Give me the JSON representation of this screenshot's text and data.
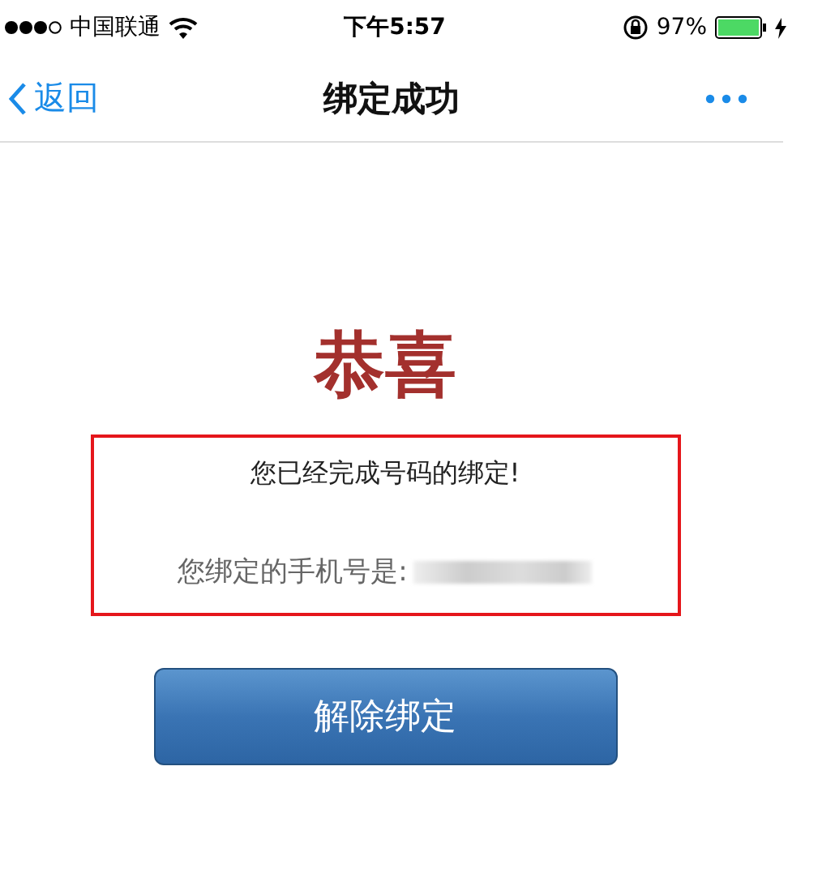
{
  "status_bar": {
    "carrier": "中国联通",
    "time": "下午5:57",
    "battery": "97%"
  },
  "nav_bar": {
    "back": "返回",
    "title": "绑定成功"
  },
  "heading": "恭喜",
  "notice": {
    "message": "您已经完成号码的绑定!",
    "phone_label": "您绑定的手机号是:"
  },
  "unbind_button": "解除绑定"
}
